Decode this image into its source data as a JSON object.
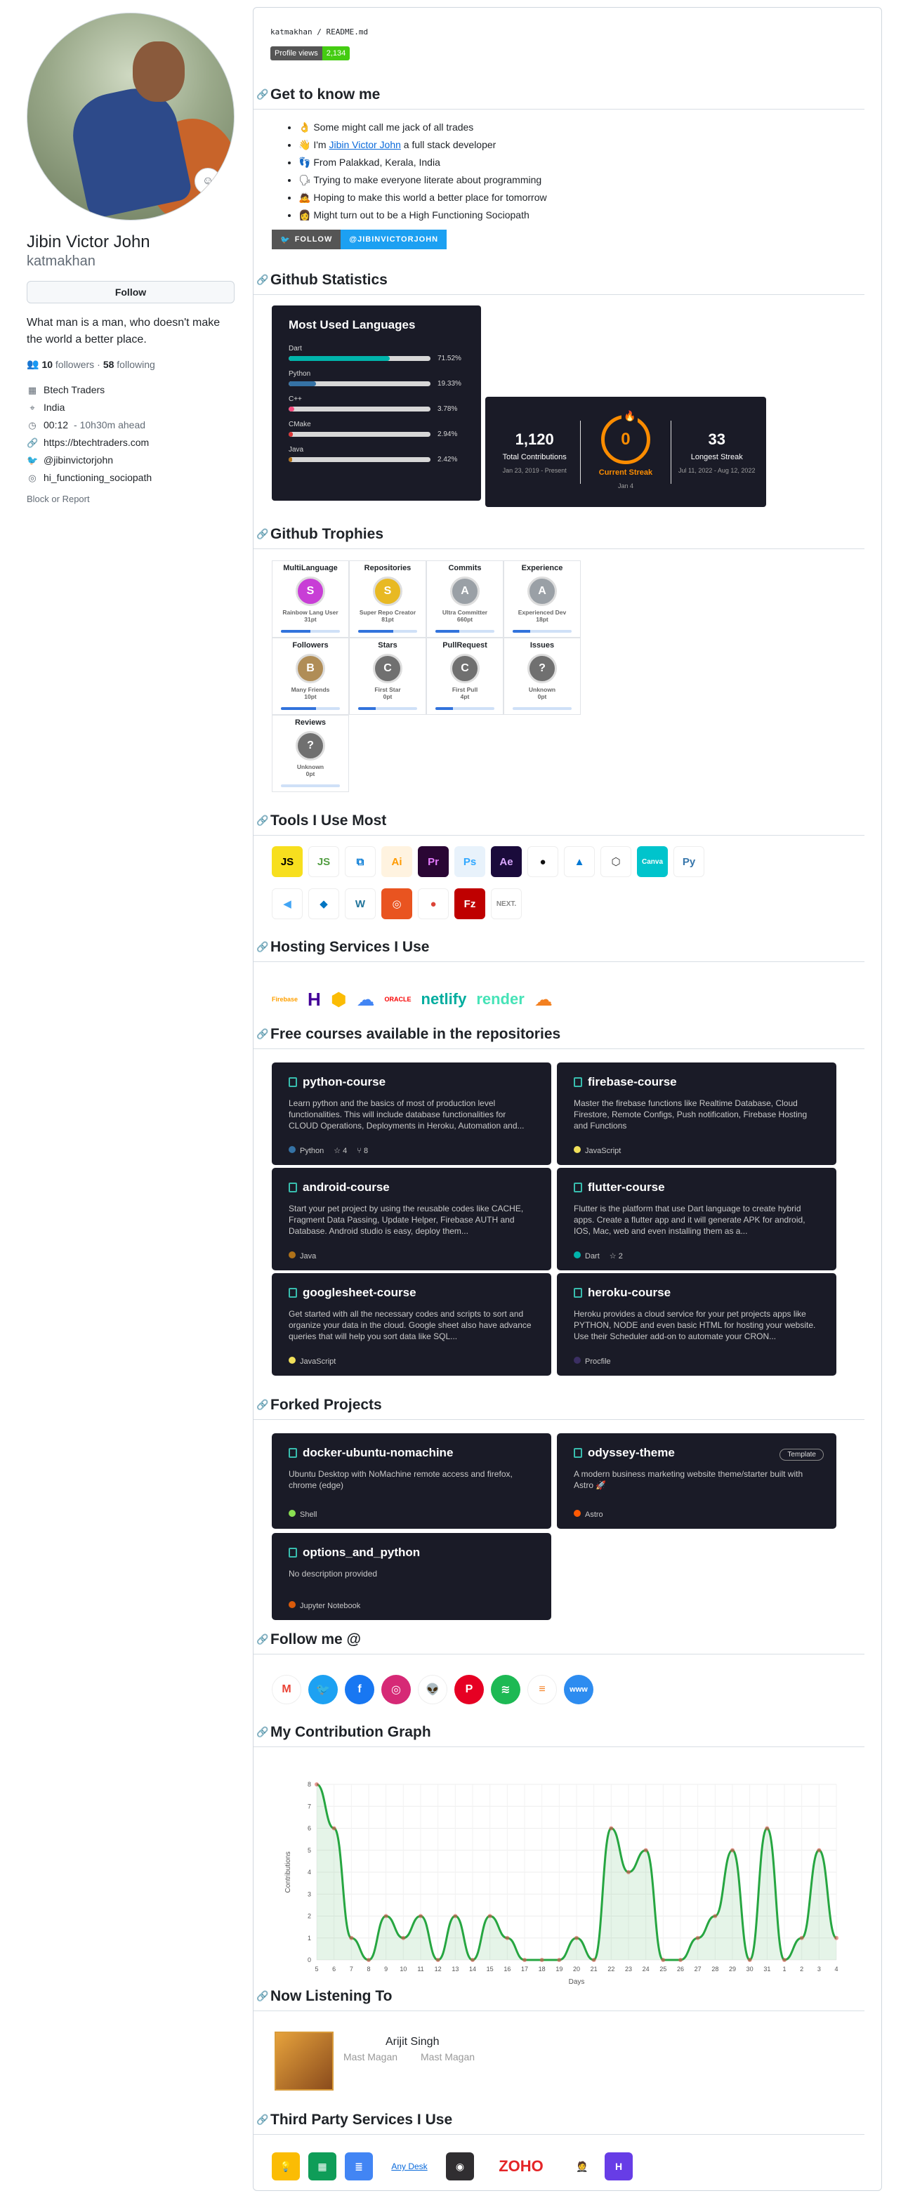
{
  "profile": {
    "full_name": "Jibin Victor John",
    "username": "katmakhan",
    "follow_label": "Follow",
    "bio": "What man is a man, who doesn't make the world a better place.",
    "followers_count": "10",
    "followers_label": "followers",
    "following_count": "58",
    "following_label": "following",
    "separator": "·",
    "company": "Btech Traders",
    "location": "India",
    "local_time": "00:12",
    "time_ahead": "- 10h30m ahead",
    "website": "https://btechtraders.com",
    "twitter": "@jibinvictorjohn",
    "instagram": "hi_functioning_sociopath",
    "block_label": "Block or Report"
  },
  "readme": {
    "path": "katmakhan / README.md",
    "views_label": "Profile views",
    "views_count": "2,134",
    "sections": {
      "know": "Get to know me",
      "stats": "Github Statistics",
      "trophies": "Github Trophies",
      "tools": "Tools I Use Most",
      "hosting": "Hosting Services I Use",
      "courses": "Free courses available in the repositories",
      "forked": "Forked Projects",
      "follow": "Follow me @",
      "graph": "My Contribution Graph",
      "listening": "Now Listening To",
      "third": "Third Party Services I Use"
    },
    "know": [
      {
        "emoji": "👌",
        "text": "Some might call me jack of all trades"
      },
      {
        "emoji": "👋",
        "pre": "I'm ",
        "link": "Jibin Victor John",
        "post": " a full stack developer"
      },
      {
        "emoji": "👣",
        "text": "From Palakkad, Kerala, India"
      },
      {
        "emoji": "🗣",
        "text": "Trying to make everyone literate about programming"
      },
      {
        "emoji": "🙇",
        "text": "Hoping to make this world a better place for tomorrow"
      },
      {
        "emoji": "👩",
        "text": "Might turn out to be a High Functioning Sociopath"
      }
    ],
    "twitter_badge": {
      "left": "FOLLOW",
      "right": "@JIBINVICTORJOHN"
    }
  },
  "languages": {
    "title": "Most Used Languages",
    "items": [
      {
        "name": "Dart",
        "pct": "71.52%",
        "value": 71.52,
        "color": "#00B4AB"
      },
      {
        "name": "Python",
        "pct": "19.33%",
        "value": 19.33,
        "color": "#3572A5"
      },
      {
        "name": "C++",
        "pct": "3.78%",
        "value": 3.78,
        "color": "#f34b7d"
      },
      {
        "name": "CMake",
        "pct": "2.94%",
        "value": 2.94,
        "color": "#DA3434"
      },
      {
        "name": "Java",
        "pct": "2.42%",
        "value": 2.42,
        "color": "#b07219"
      }
    ]
  },
  "streak": {
    "total": "1,120",
    "total_label": "Total Contributions",
    "total_range": "Jan 23, 2019 - Present",
    "current": "0",
    "current_label": "Current Streak",
    "current_date": "Jan 4",
    "longest": "33",
    "longest_label": "Longest Streak",
    "longest_range": "Jul 11, 2022 - Aug 12, 2022"
  },
  "trophies": [
    {
      "title": "MultiLanguage",
      "rank": "S",
      "desc": "Rainbow Lang User",
      "points": "31pt",
      "progress": 0.5,
      "color": "#c83ed6"
    },
    {
      "title": "Repositories",
      "rank": "S",
      "desc": "Super Repo Creator",
      "points": "81pt",
      "progress": 0.6,
      "color": "#e8b923"
    },
    {
      "title": "Commits",
      "rank": "A",
      "desc": "Ultra Committer",
      "points": "660pt",
      "progress": 0.4,
      "color": "#9aa0a6"
    },
    {
      "title": "Experience",
      "rank": "A",
      "desc": "Experienced Dev",
      "points": "18pt",
      "progress": 0.3,
      "color": "#9aa0a6"
    },
    {
      "title": "Followers",
      "rank": "B",
      "desc": "Many Friends",
      "points": "10pt",
      "progress": 0.6,
      "color": "#b08d57"
    },
    {
      "title": "Stars",
      "rank": "C",
      "desc": "First Star",
      "points": "0pt",
      "progress": 0.3,
      "color": "#707070"
    },
    {
      "title": "PullRequest",
      "rank": "C",
      "desc": "First Pull",
      "points": "4pt",
      "progress": 0.3,
      "color": "#707070"
    },
    {
      "title": "Issues",
      "rank": "?",
      "desc": "Unknown",
      "points": "0pt",
      "progress": 0.0,
      "color": "#707070"
    },
    {
      "title": "Reviews",
      "rank": "?",
      "desc": "Unknown",
      "points": "0pt",
      "progress": 0.0,
      "color": "#707070"
    }
  ],
  "tools_row1": [
    {
      "icon": "javascript-icon",
      "glyph": "JS",
      "bg": "#f7df1e",
      "fg": "#000"
    },
    {
      "icon": "nodejs-icon",
      "glyph": "JS",
      "bg": "#ffffff",
      "fg": "#539e43"
    },
    {
      "icon": "vscode-icon",
      "glyph": "⧉",
      "bg": "#ffffff",
      "fg": "#0078d4"
    },
    {
      "icon": "illustrator-icon",
      "glyph": "Ai",
      "bg": "#fff3e0",
      "fg": "#ff9a00"
    },
    {
      "icon": "premiere-icon",
      "glyph": "Pr",
      "bg": "#2a0634",
      "fg": "#e77bff"
    },
    {
      "icon": "photoshop-icon",
      "glyph": "Ps",
      "bg": "#e8f2fb",
      "fg": "#31a8ff"
    },
    {
      "icon": "aftereffects-icon",
      "glyph": "Ae",
      "bg": "#1a0b3b",
      "fg": "#d9a8ff"
    },
    {
      "icon": "github-icon",
      "glyph": "●",
      "bg": "#ffffff",
      "fg": "#111"
    },
    {
      "icon": "azure-devops-icon",
      "glyph": "▲",
      "bg": "#ffffff",
      "fg": "#0078d4"
    },
    {
      "icon": "bash-icon",
      "glyph": "⬡",
      "bg": "#ffffff",
      "fg": "#333"
    },
    {
      "icon": "canva-icon",
      "glyph": "Canva",
      "bg": "#00c4cc",
      "fg": "#fff"
    },
    {
      "icon": "python-icon",
      "glyph": "Py",
      "bg": "#ffffff",
      "fg": "#3776ab"
    }
  ],
  "tools_row2": [
    {
      "icon": "flutter-icon",
      "glyph": "◀",
      "bg": "#ffffff",
      "fg": "#42a5f5"
    },
    {
      "icon": "dart-icon",
      "glyph": "◆",
      "bg": "#ffffff",
      "fg": "#0175c2"
    },
    {
      "icon": "wordpress-icon",
      "glyph": "W",
      "bg": "#ffffff",
      "fg": "#21759b"
    },
    {
      "icon": "ubuntu-icon",
      "glyph": "◎",
      "bg": "#e95420",
      "fg": "#fff"
    },
    {
      "icon": "chrome-icon",
      "glyph": "●",
      "bg": "#ffffff",
      "fg": "#db4437"
    },
    {
      "icon": "filezilla-icon",
      "glyph": "Fz",
      "bg": "#bf0000",
      "fg": "#fff"
    },
    {
      "icon": "nextjs-icon",
      "glyph": "NEXT.",
      "bg": "#ffffff",
      "fg": "#888"
    }
  ],
  "hosting": [
    {
      "icon": "firebase-icon",
      "label": "Firebase",
      "color": "#ffa000"
    },
    {
      "icon": "heroku-icon",
      "label": "H",
      "color": "#430098"
    },
    {
      "icon": "gcp-icon",
      "label": "⬢",
      "color": "#fbbc05"
    },
    {
      "icon": "google-cloud-icon",
      "label": "☁",
      "color": "#4285f4"
    },
    {
      "icon": "oracle-icon",
      "label": "ORACLE",
      "color": "#f80000"
    },
    {
      "icon": "netlify-icon",
      "label": "netlify",
      "color": "#00ad9f"
    },
    {
      "icon": "render-icon",
      "label": "render",
      "color": "#46e3b7"
    },
    {
      "icon": "cloudflare-icon",
      "label": "☁",
      "color": "#f38020"
    }
  ],
  "courses": [
    {
      "name": "python-course",
      "desc": "Learn python and the basics of most of production level functionalities. This will include database functionalities for CLOUD Operations, Deployments in Heroku, Automation and...",
      "lang": "Python",
      "lang_color": "#3572A5",
      "stars": "4",
      "forks": "8"
    },
    {
      "name": "firebase-course",
      "desc": "Master the firebase functions like Realtime Database, Cloud Firestore, Remote Configs, Push notification, Firebase Hosting and Functions",
      "lang": "JavaScript",
      "lang_color": "#f1e05a",
      "stars": "",
      "forks": ""
    },
    {
      "name": "android-course",
      "desc": "Start your pet project by using the reusable codes like CACHE, Fragment Data Passing, Update Helper, Firebase AUTH and Database. Android studio is easy, deploy them...",
      "lang": "Java",
      "lang_color": "#b07219",
      "stars": "",
      "forks": ""
    },
    {
      "name": "flutter-course",
      "desc": "Flutter is the platform that use Dart language to create hybrid apps. Create a flutter app and it will generate APK for android, IOS, Mac, web and even installing them as a...",
      "lang": "Dart",
      "lang_color": "#00B4AB",
      "stars": "2",
      "forks": ""
    },
    {
      "name": "googlesheet-course",
      "desc": "Get started with all the necessary codes and scripts to sort and organize your data in the cloud. Google sheet also have advance queries that will help you sort data like SQL...",
      "lang": "JavaScript",
      "lang_color": "#f1e05a",
      "stars": "",
      "forks": ""
    },
    {
      "name": "heroku-course",
      "desc": "Heroku provides a cloud service for your pet projects apps like PYTHON, NODE and even basic HTML for hosting your website. Use their Scheduler add-on to automate your CRON...",
      "lang": "Procfile",
      "lang_color": "#3B2F63",
      "stars": "",
      "forks": ""
    }
  ],
  "forked": [
    {
      "name": "docker-ubuntu-nomachine",
      "desc": "Ubuntu Desktop with NoMachine remote access and firefox, chrome (edge)",
      "lang": "Shell",
      "lang_color": "#89e051",
      "template": ""
    },
    {
      "name": "odyssey-theme",
      "desc": "A modern business marketing website theme/starter built with Astro 🚀",
      "lang": "Astro",
      "lang_color": "#ff5a03",
      "template": "Template"
    },
    {
      "name": "options_and_python",
      "desc": "No description provided",
      "lang": "Jupyter Notebook",
      "lang_color": "#DA5B0B",
      "template": ""
    }
  ],
  "social": [
    {
      "icon": "gmail-icon",
      "glyph": "M",
      "bg": "#ffffff",
      "fg": "#ea4335"
    },
    {
      "icon": "twitter-icon",
      "glyph": "🐦",
      "bg": "#1da1f2",
      "fg": "#fff"
    },
    {
      "icon": "facebook-icon",
      "glyph": "f",
      "bg": "#1877f2",
      "fg": "#fff"
    },
    {
      "icon": "instagram-icon",
      "glyph": "◎",
      "bg": "#d62976",
      "fg": "#fff"
    },
    {
      "icon": "reddit-icon",
      "glyph": "👽",
      "bg": "#ffffff",
      "fg": "#ff4500"
    },
    {
      "icon": "pinterest-icon",
      "glyph": "P",
      "bg": "#e60023",
      "fg": "#fff"
    },
    {
      "icon": "spotify-icon",
      "glyph": "≋",
      "bg": "#1db954",
      "fg": "#fff"
    },
    {
      "icon": "stackoverflow-icon",
      "glyph": "≡",
      "bg": "#ffffff",
      "fg": "#f48024"
    },
    {
      "icon": "website-icon",
      "glyph": "www",
      "bg": "#2d8cf0",
      "fg": "#fff"
    }
  ],
  "listening": {
    "artist": "Arijit Singh",
    "song": "Mast Magan",
    "album": "Mast Magan"
  },
  "third_party": [
    {
      "icon": "google-keep-icon",
      "glyph": "💡",
      "bg": "#fbbc04"
    },
    {
      "icon": "google-sheets-icon",
      "glyph": "▦",
      "bg": "#0f9d58"
    },
    {
      "icon": "google-docs-icon",
      "glyph": "≣",
      "bg": "#4285f4"
    },
    {
      "icon": "anydesk-icon",
      "glyph": "",
      "bg": "transparent",
      "alt": "Any Desk"
    },
    {
      "icon": "obs-icon",
      "glyph": "◉",
      "bg": "#302e31"
    },
    {
      "icon": "zoho-icon",
      "glyph": "ZOHO",
      "bg": "transparent"
    },
    {
      "icon": "postman-icon",
      "glyph": "🤵",
      "bg": "#ffffff"
    },
    {
      "icon": "hostinger-icon",
      "glyph": "H",
      "bg": "#673de6"
    }
  ],
  "chart_data": {
    "type": "area",
    "title": "",
    "xlabel": "Days",
    "ylabel": "Contributions",
    "ylim": [
      0,
      8
    ],
    "yticks": [
      0,
      1,
      2,
      3,
      4,
      5,
      6,
      7,
      8
    ],
    "x": [
      "5",
      "6",
      "7",
      "8",
      "9",
      "10",
      "11",
      "12",
      "13",
      "14",
      "15",
      "16",
      "17",
      "18",
      "19",
      "20",
      "21",
      "22",
      "23",
      "24",
      "25",
      "26",
      "27",
      "28",
      "29",
      "30",
      "31",
      "1",
      "2",
      "3",
      "4"
    ],
    "series": [
      {
        "values": [
          8,
          6,
          1,
          0,
          2,
          1,
          2,
          0,
          2,
          0,
          2,
          1,
          0,
          0,
          0,
          1,
          0,
          6,
          4,
          5,
          0,
          0,
          1,
          2,
          5,
          0,
          6,
          0,
          1,
          5,
          1
        ]
      }
    ],
    "grid": true,
    "color": "#26a641"
  }
}
